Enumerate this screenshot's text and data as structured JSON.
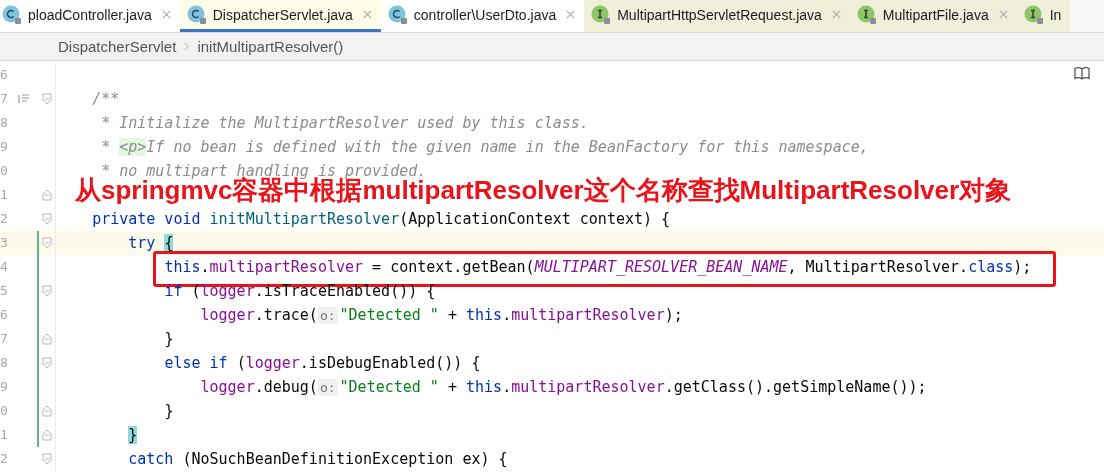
{
  "tabs": [
    {
      "label": "ploadController.java",
      "kind": "class",
      "color": "#ffffff",
      "selected": false
    },
    {
      "label": "DispatcherServlet.java",
      "kind": "class",
      "color": "#fdfce6",
      "selected": true
    },
    {
      "label": "controller\\UserDto.java",
      "kind": "class",
      "color": "#ffffff",
      "selected": false
    },
    {
      "label": "MultipartHttpServletRequest.java",
      "kind": "interface",
      "color": "#efefda",
      "selected": false
    },
    {
      "label": "MultipartFile.java",
      "kind": "interface",
      "color": "#efefda",
      "selected": false
    },
    {
      "label": "In",
      "kind": "interface",
      "color": "#efefda",
      "selected": false
    }
  ],
  "breadcrumb": [
    "DispatcherServlet",
    "initMultipartResolver()"
  ],
  "lines": [
    {
      "number": "6"
    },
    {
      "number": "7",
      "doc_toggle": true,
      "fold": {
        "kind": "start"
      },
      "tokens": [
        {
          "kind": "comment",
          "text": "    /**"
        }
      ]
    },
    {
      "number": "8",
      "tokens": [
        {
          "kind": "comment",
          "text": "     * Initialize the MultipartResolver used by this class."
        }
      ]
    },
    {
      "number": "9",
      "tokens": [
        {
          "kind": "comment",
          "text": "     * "
        },
        {
          "kind": "doc-tag",
          "text": "<p>"
        },
        {
          "kind": "comment",
          "text": "If no bean is defined with the given name in the BeanFactory for this namespace,"
        }
      ]
    },
    {
      "number": "0",
      "tokens": [
        {
          "kind": "comment",
          "text": "     * no multipart handling is provided."
        }
      ]
    },
    {
      "number": "1",
      "fold": {
        "kind": "end"
      }
    },
    {
      "number": "2",
      "fold": {
        "kind": "start"
      },
      "tokens": [
        {
          "kind": "keyword",
          "text": "    private void "
        },
        {
          "kind": "method",
          "text": "initMultipartResolver"
        },
        {
          "kind": "plain",
          "text": "(ApplicationContext context) {"
        }
      ]
    },
    {
      "number": "3",
      "fold": {
        "kind": "start"
      },
      "current": true,
      "modified": true,
      "tokens": [
        {
          "kind": "keyword",
          "text": "        try "
        },
        {
          "kind": "brace",
          "text": "{"
        }
      ]
    },
    {
      "number": "4",
      "boxed": true,
      "modified": true,
      "tokens": [
        {
          "kind": "keyword",
          "text": "            this"
        },
        {
          "kind": "plain",
          "text": "."
        },
        {
          "kind": "field",
          "text": "multipartResolver"
        },
        {
          "kind": "plain",
          "text": " = context.getBean("
        },
        {
          "kind": "constant",
          "text": "MULTIPART_RESOLVER_BEAN_NAME"
        },
        {
          "kind": "plain",
          "text": ", MultipartResolver."
        },
        {
          "kind": "keyword",
          "text": "class"
        },
        {
          "kind": "plain",
          "text": ");"
        }
      ]
    },
    {
      "number": "5",
      "fold": {
        "kind": "start"
      },
      "modified": true,
      "tokens": [
        {
          "kind": "keyword",
          "text": "            if "
        },
        {
          "kind": "plain",
          "text": "("
        },
        {
          "kind": "field",
          "text": "logger"
        },
        {
          "kind": "plain",
          "text": ".isTraceEnabled()) {"
        }
      ]
    },
    {
      "number": "6",
      "modified": true,
      "tokens": [
        {
          "kind": "field",
          "text": "                logger"
        },
        {
          "kind": "plain",
          "text": ".trace("
        },
        {
          "kind": "hint",
          "text": "o:"
        },
        {
          "kind": "string",
          "text": "\"Detected \""
        },
        {
          "kind": "plain",
          "text": " + "
        },
        {
          "kind": "keyword",
          "text": "this"
        },
        {
          "kind": "plain",
          "text": "."
        },
        {
          "kind": "field",
          "text": "multipartResolver"
        },
        {
          "kind": "plain",
          "text": ");"
        }
      ]
    },
    {
      "number": "7",
      "fold": {
        "kind": "end"
      },
      "modified": true,
      "tokens": [
        {
          "kind": "plain",
          "text": "            }"
        }
      ]
    },
    {
      "number": "8",
      "fold": {
        "kind": "start"
      },
      "modified": true,
      "tokens": [
        {
          "kind": "keyword",
          "text": "            else if "
        },
        {
          "kind": "plain",
          "text": "("
        },
        {
          "kind": "field",
          "text": "logger"
        },
        {
          "kind": "plain",
          "text": ".isDebugEnabled()) {"
        }
      ]
    },
    {
      "number": "9",
      "modified": true,
      "tokens": [
        {
          "kind": "field",
          "text": "                logger"
        },
        {
          "kind": "plain",
          "text": ".debug("
        },
        {
          "kind": "hint",
          "text": "o:"
        },
        {
          "kind": "string",
          "text": "\"Detected \""
        },
        {
          "kind": "plain",
          "text": " + "
        },
        {
          "kind": "keyword",
          "text": "this"
        },
        {
          "kind": "plain",
          "text": "."
        },
        {
          "kind": "field",
          "text": "multipartResolver"
        },
        {
          "kind": "plain",
          "text": ".getClass().getSimpleName());"
        }
      ]
    },
    {
      "number": "0",
      "fold": {
        "kind": "end"
      },
      "modified": true,
      "tokens": [
        {
          "kind": "plain",
          "text": "            }"
        }
      ]
    },
    {
      "number": "1",
      "fold": {
        "kind": "end"
      },
      "modified": true,
      "tokens": [
        {
          "kind": "brace",
          "text": "        }"
        }
      ]
    },
    {
      "number": "2",
      "fold": {
        "kind": "start"
      },
      "tokens": [
        {
          "kind": "keyword",
          "text": "        catch "
        },
        {
          "kind": "plain",
          "text": "(NoSuchBeanDefinitionException ex) {"
        }
      ]
    }
  ],
  "annotation": {
    "text": "从springmvc容器中根据multipartResolver这个名称查找MultipartResolver对象"
  }
}
